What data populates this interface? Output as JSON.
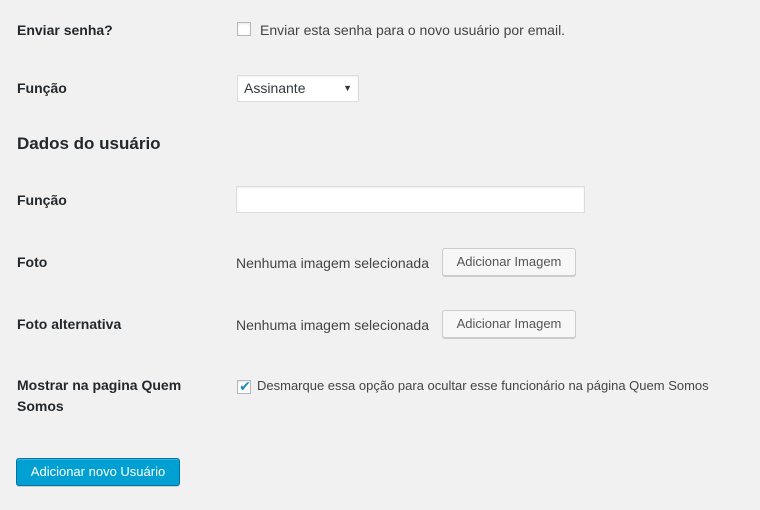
{
  "send_password": {
    "label": "Enviar senha?",
    "checkbox_text": "Enviar esta senha para o novo usuário por email.",
    "checked": false
  },
  "role": {
    "label": "Função",
    "selected": "Assinante"
  },
  "user_data": {
    "section_title": "Dados do usuário",
    "funcao_label": "Função",
    "funcao_value": "",
    "foto_label": "Foto",
    "foto_status": "Nenhuma imagem selecionada",
    "foto_button": "Adicionar Imagem",
    "foto_alt_label": "Foto alternativa",
    "foto_alt_status": "Nenhuma imagem selecionada",
    "foto_alt_button": "Adicionar Imagem",
    "show_label_line1": "Mostrar na pagina Quem",
    "show_label_line2": "Somos",
    "show_checkbox_text": "Desmarque essa opção para ocultar esse funcionário na página Quem Somos",
    "show_checked": true
  },
  "submit_label": "Adicionar novo Usuário",
  "colors": {
    "background": "#f1f1f1",
    "primary_button": "#00a0d2",
    "check_mark": "#1e8cbe"
  }
}
